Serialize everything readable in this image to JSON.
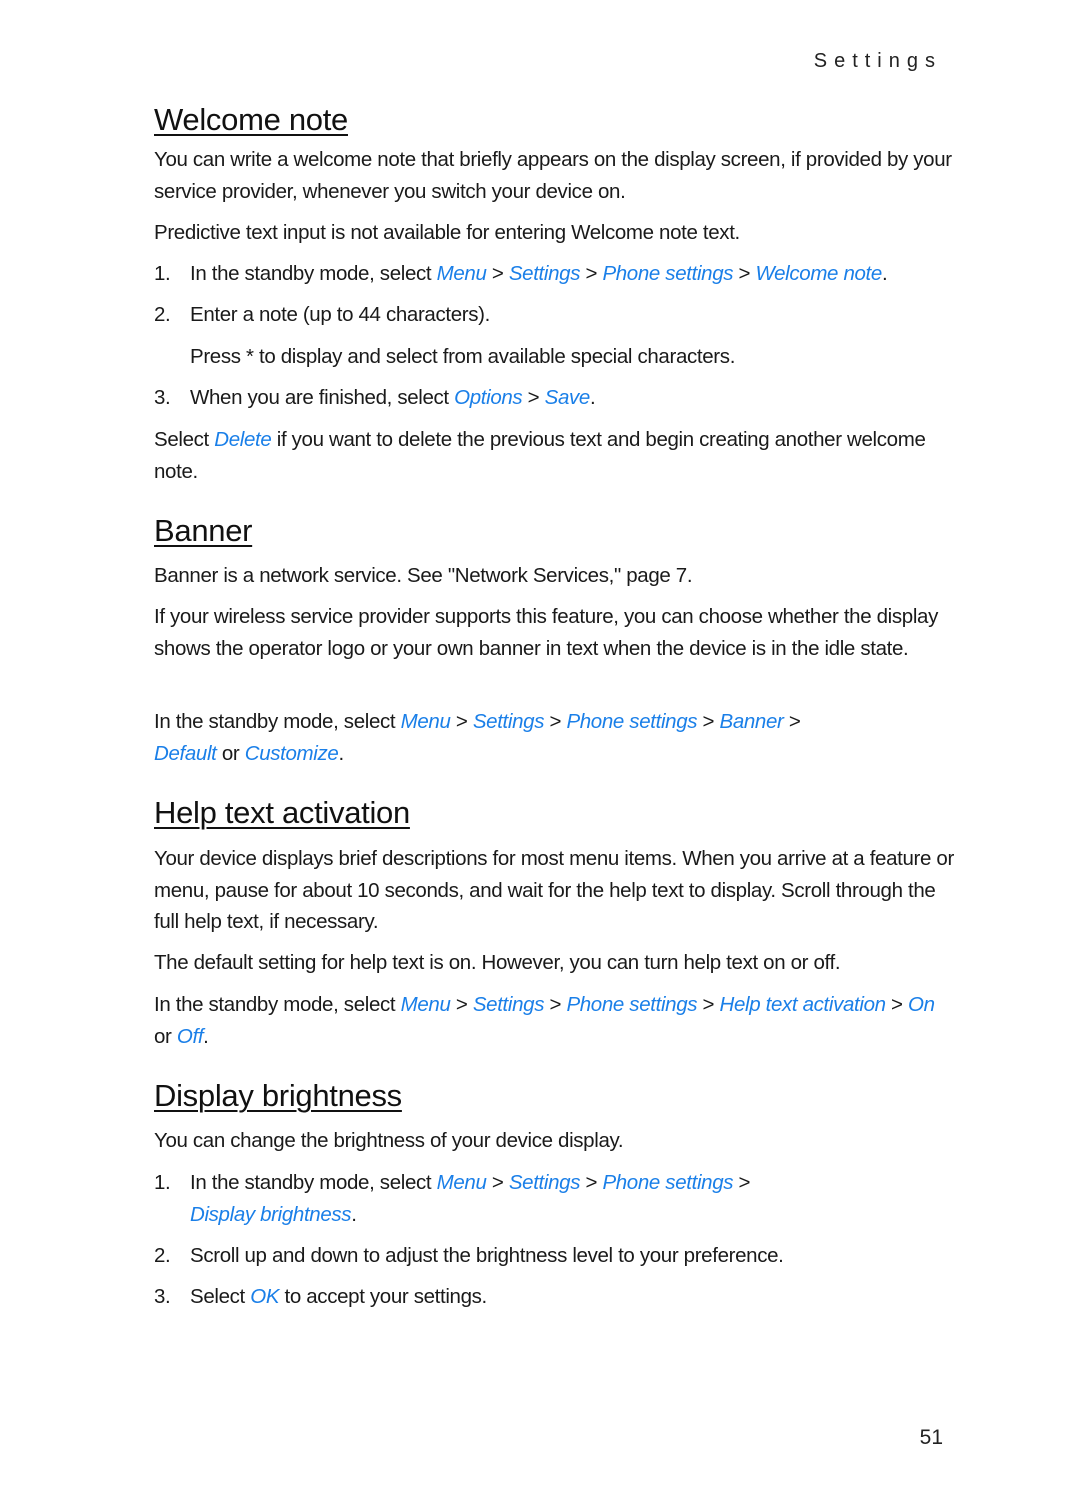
{
  "header": {
    "running_head": "Settings",
    "page_number": "51"
  },
  "colors": {
    "link": "#1a7fe8",
    "text": "#1a1a1a"
  },
  "sections": {
    "welcome": {
      "title": "Welcome note",
      "p1": "You can write a welcome note that briefly appears on the display screen, if provided by your service provider, whenever you switch your device on.",
      "p2": "Predictive text input is not available for entering Welcome note text.",
      "step1": {
        "num": "1.",
        "prefix": "In the standby mode, select ",
        "path": [
          "Menu",
          "Settings",
          "Phone settings",
          "Welcome note"
        ],
        "suffix": "."
      },
      "step2": {
        "num": "2.",
        "text": "Enter a note (up to 44 characters).",
        "sub": "Press * to display and select from available special characters."
      },
      "step3": {
        "num": "3.",
        "prefix": "When you are finished, select ",
        "path": [
          "Options",
          "Save"
        ],
        "suffix": "."
      },
      "p3": {
        "prefix": "Select ",
        "link": "Delete",
        "suffix": " if you want to delete the previous text and begin creating another welcome note."
      }
    },
    "banner": {
      "title": "Banner",
      "p1": "Banner is a network service. See \"Network Services,\" page 7.",
      "p2": "If your wireless service provider supports this feature, you can choose whether the display shows the operator logo or your own banner in text when the device is in the idle state.",
      "p3": {
        "prefix": "In the standby mode, select ",
        "path": [
          "Menu",
          "Settings",
          "Phone settings",
          "Banner"
        ],
        "option_a": "Default",
        "or": " or ",
        "option_b": "Customize",
        "suffix": "."
      }
    },
    "help": {
      "title": "Help text activation",
      "p1": "Your device displays brief descriptions for most menu items. When you arrive at a feature or menu, pause for about 10 seconds, and wait for the help text to display. Scroll through the full help text, if necessary.",
      "p2": "The default setting for help text is on. However, you can turn help text on or off.",
      "p3": {
        "prefix": "In the standby mode, select ",
        "path": [
          "Menu",
          "Settings",
          "Phone settings",
          "Help text activation"
        ],
        "option_a": "On",
        "or": " or ",
        "option_b": "Off",
        "suffix": "."
      }
    },
    "brightness": {
      "title": "Display brightness",
      "p1": "You can change the brightness of your device display.",
      "step1": {
        "num": "1.",
        "prefix": "In the standby mode, select ",
        "path": [
          "Menu",
          "Settings",
          "Phone settings",
          "Display brightness"
        ],
        "suffix": "."
      },
      "step2": {
        "num": "2.",
        "text": "Scroll up and down to adjust the brightness level to your preference."
      },
      "step3": {
        "num": "3.",
        "prefix": "Select ",
        "link": "OK",
        "suffix": " to accept your settings."
      }
    }
  }
}
